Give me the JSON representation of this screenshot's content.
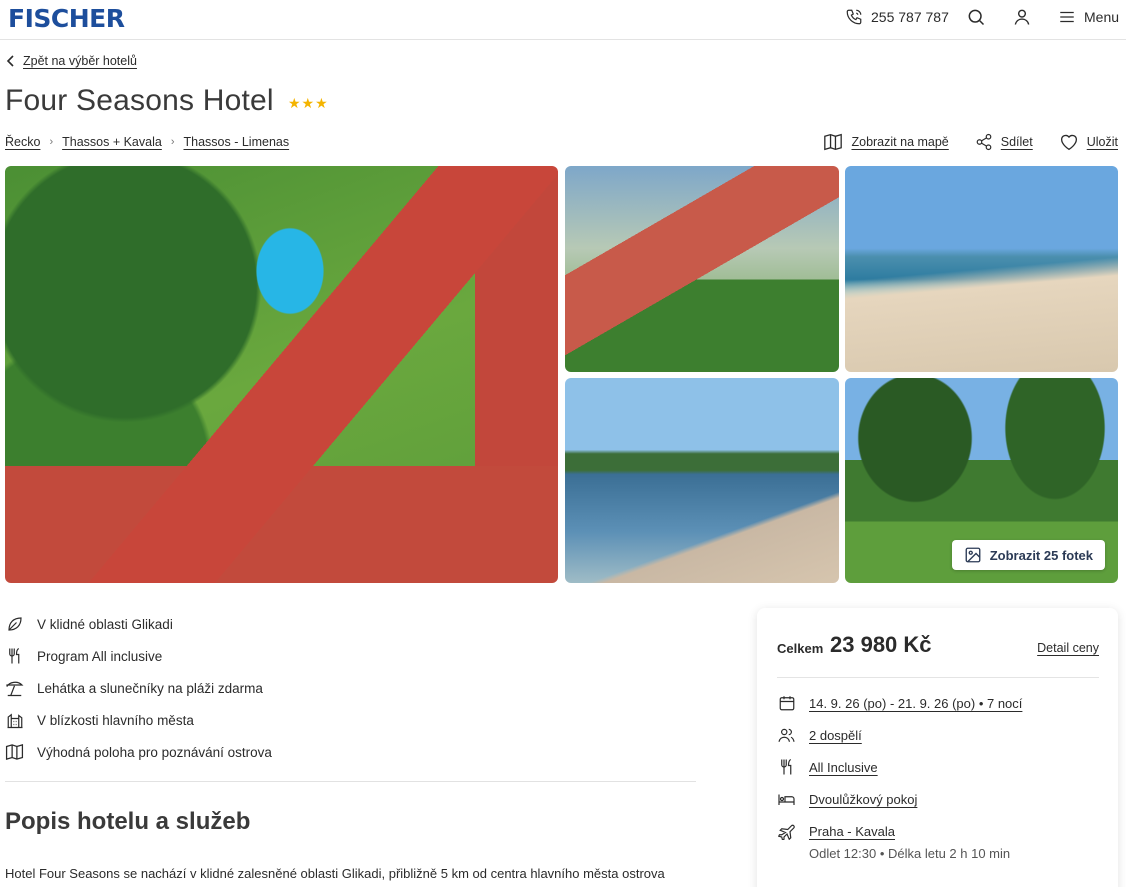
{
  "header": {
    "logo": "FISCHER",
    "phone": "255 787 787",
    "menu_label": "Menu"
  },
  "back_link": "Zpět na výběr hotelů",
  "hotel": {
    "name": "Four Seasons Hotel",
    "stars": "★★★"
  },
  "breadcrumbs": [
    "Řecko",
    "Thassos + Kavala",
    "Thassos - Limenas"
  ],
  "actions": {
    "map": "Zobrazit na mapě",
    "share": "Sdílet",
    "save": "Uložit"
  },
  "gallery": {
    "photos_button": "Zobrazit 25 fotek"
  },
  "features": [
    {
      "icon": "leaf-icon",
      "label": "V klidné oblasti Glikadi"
    },
    {
      "icon": "cutlery-icon",
      "label": "Program All inclusive"
    },
    {
      "icon": "umbrella-icon",
      "label": "Lehátka a slunečníky na pláži zdarma"
    },
    {
      "icon": "city-icon",
      "label": "V blízkosti hlavního města"
    },
    {
      "icon": "map-icon",
      "label": "Výhodná poloha pro poznávání ostrova"
    }
  ],
  "section": {
    "title": "Popis hotelu a služeb",
    "description": "Hotel Four Seasons se nachází v klidné zalesněné oblasti Glikadi, přibližně 5 km od centra hlavního města ostrova"
  },
  "price_card": {
    "total_label": "Celkem",
    "total_value": "23 980 Kč",
    "detail_link": "Detail ceny",
    "dates": "14. 9. 26 (po) - 21. 9. 26 (po) • 7 nocí",
    "persons": "2 dospělí",
    "board": "All Inclusive",
    "room": "Dvoulůžkový pokoj",
    "flight": "Praha - Kavala",
    "flight_info": "Odlet 12:30 • Délka letu 2 h 10 min"
  }
}
